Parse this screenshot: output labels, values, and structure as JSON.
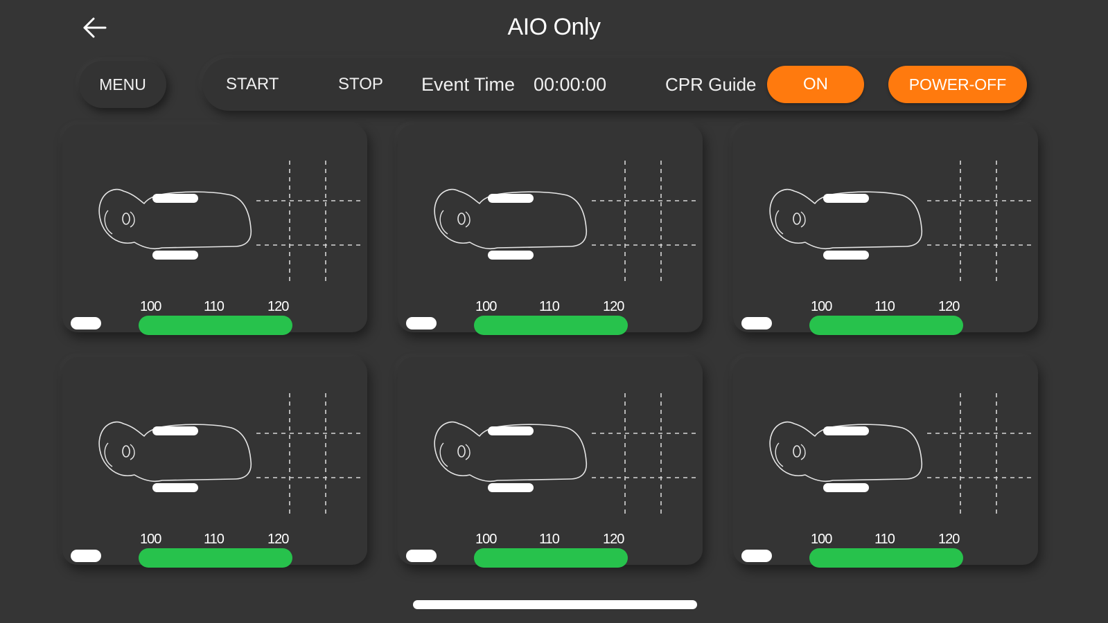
{
  "header": {
    "title": "AIO Only",
    "back_icon": "back-arrow-icon"
  },
  "toolbar": {
    "menu_label": "MENU",
    "start_label": "START",
    "stop_label": "STOP",
    "event_time_label": "Event Time",
    "event_time_value": "00:00:00",
    "cpr_guide_label": "CPR Guide",
    "cpr_guide_toggle": "ON",
    "power_off_label": "POWER-OFF"
  },
  "colors": {
    "background": "#353535",
    "accent_orange": "#ff7a0e",
    "rate_green": "#27c24c"
  },
  "cards": [
    {
      "ticks": [
        "100",
        "110",
        "120"
      ]
    },
    {
      "ticks": [
        "100",
        "110",
        "120"
      ]
    },
    {
      "ticks": [
        "100",
        "110",
        "120"
      ]
    },
    {
      "ticks": [
        "100",
        "110",
        "120"
      ]
    },
    {
      "ticks": [
        "100",
        "110",
        "120"
      ]
    },
    {
      "ticks": [
        "100",
        "110",
        "120"
      ]
    }
  ]
}
